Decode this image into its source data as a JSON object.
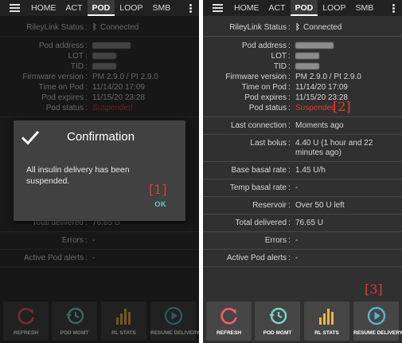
{
  "nav_tabs": [
    "HOME",
    "ACT",
    "POD",
    "LOOP",
    "SMB"
  ],
  "active_tab_index": 2,
  "pod_info": {
    "rileylink_label": "RileyLink Status",
    "rileylink_value": "Connected",
    "pod_address_label": "Pod address",
    "lot_label": "LOT",
    "tid_label": "TID",
    "firmware_label": "Firmware version",
    "firmware_value": "PM 2.9.0 / PI 2.9.0",
    "time_on_pod_label": "Time on Pod",
    "time_on_pod_value": "11/14/20 17:09",
    "pod_expires_label": "Pod expires",
    "pod_expires_value": "11/15/20 23:28",
    "pod_status_label": "Pod status",
    "pod_status_value": "Suspended",
    "last_connection_label": "Last connection",
    "last_connection_value": "Moments ago",
    "last_bolus_label": "Last bolus",
    "last_bolus_value": "4.40 U (1 hour and 22 minutes ago)",
    "base_basal_label": "Base basal rate",
    "base_basal_value": "1.45 U/h",
    "temp_basal_label": "Temp basal rate",
    "temp_basal_value": "-",
    "reservoir_label": "Reservoir",
    "reservoir_value": "Over 50 U left",
    "total_delivered_label": "Total delivered",
    "total_delivered_value": "76.65 U",
    "errors_label": "Errors",
    "errors_value": "-",
    "active_alerts_label": "Active Pod alerts",
    "active_alerts_value": "-",
    "separator": ":"
  },
  "dialog": {
    "title": "Confirmation",
    "message": "All insulin delivery has been suspended.",
    "ok_label": "OK"
  },
  "callouts": {
    "one": "[1]",
    "two": "[2]",
    "three": "[3]"
  },
  "buttons": {
    "refresh": "REFRESH",
    "pod_mgmt": "POD MGMT",
    "rl_stats": "RL STATS",
    "resume_delivery": "RESUME DELIVERY"
  },
  "colors": {
    "background": "#303030",
    "topbar": "#212121",
    "suspended_red": "#e53935",
    "dialog_ok_teal": "#5ccfbf",
    "refresh_icon": "#ff5a6e",
    "pod_mgmt_icon": "#7bd3c9",
    "rl_stats_icon": "#f4b53a",
    "resume_icon": "#5ab3ce"
  },
  "icons": {
    "menu": "hamburger-menu-icon",
    "overflow": "overflow-menu-icon",
    "bluetooth": "bluetooth-icon",
    "check": "check-icon",
    "refresh": "refresh-icon",
    "pod_mgmt": "history-clock-icon",
    "rl_stats": "bar-stats-icon",
    "resume": "play-circle-icon"
  }
}
